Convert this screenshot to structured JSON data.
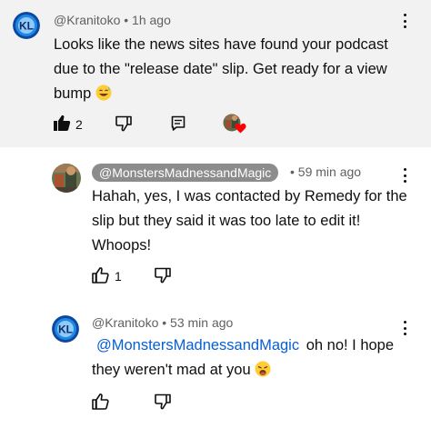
{
  "comments": [
    {
      "author": "@Kranitoko",
      "time": "1h ago",
      "text": "Looks like the news sites have found your podcast due to the \"release date\" slip. Get ready for a view bump",
      "emoji": "sweat-smile",
      "likes": "2",
      "liked": true,
      "creator_hearted": true
    },
    {
      "author": "@MonstersMadnessandMagic",
      "time": "59 min ago",
      "text": "Hahah, yes, I was contacted by Remedy for the slip but they said it was too late to edit it! Whoops!",
      "likes": "1"
    },
    {
      "author": "@Kranitoko",
      "time": "53 min ago",
      "mention": "@MonstersMadnessandMagic",
      "text": "oh no! I hope they weren't mad at you",
      "emoji": "weary-face"
    }
  ],
  "separator": "•",
  "icons": {
    "avatar_kranitoko": "kl-logo-avatar",
    "avatar_channel": "channel-avatar",
    "like": "thumbs-up-icon",
    "dislike": "thumbs-down-icon",
    "reply": "reply-icon",
    "more": "more-vert-icon",
    "heart": "creator-heart-icon"
  },
  "colors": {
    "top_bg": "#f2f2f2",
    "chip_bg": "#8c8c8c",
    "mention": "#065fd4",
    "heart": "#ff0000",
    "avatar_blue": "#1565c0"
  }
}
